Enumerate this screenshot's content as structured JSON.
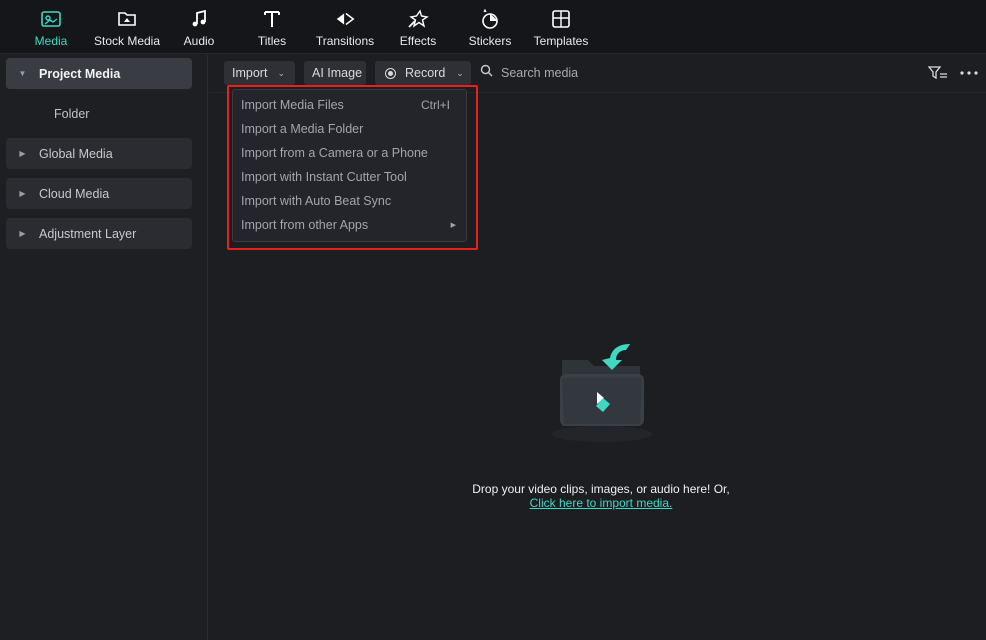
{
  "toolbar": {
    "tabs": [
      {
        "label": "Media",
        "icon": "media-icon",
        "active": true
      },
      {
        "label": "Stock Media",
        "icon": "stock-media-icon",
        "active": false
      },
      {
        "label": "Audio",
        "icon": "music-note-icon",
        "active": false
      },
      {
        "label": "Titles",
        "icon": "titles-icon",
        "active": false
      },
      {
        "label": "Transitions",
        "icon": "transitions-icon",
        "active": false
      },
      {
        "label": "Effects",
        "icon": "effects-icon",
        "active": false
      },
      {
        "label": "Stickers",
        "icon": "stickers-icon",
        "active": false
      },
      {
        "label": "Templates",
        "icon": "templates-icon",
        "active": false
      }
    ]
  },
  "sidebar": {
    "items": [
      {
        "label": "Project Media",
        "expanded": true
      },
      {
        "label": "Folder"
      },
      {
        "label": "Global Media",
        "expanded": false
      },
      {
        "label": "Cloud Media",
        "expanded": false
      },
      {
        "label": "Adjustment Layer",
        "expanded": false
      }
    ]
  },
  "main": {
    "import_label": "Import",
    "ai_image_label": "AI Image",
    "record_label": "Record",
    "search_placeholder": "Search media"
  },
  "import_menu": {
    "items": [
      {
        "label": "Import Media Files",
        "shortcut": "Ctrl+I"
      },
      {
        "label": "Import a Media Folder"
      },
      {
        "label": "Import from a Camera or a Phone"
      },
      {
        "label": "Import with Instant Cutter Tool"
      },
      {
        "label": "Import with Auto Beat Sync"
      },
      {
        "label": "Import from other Apps",
        "has_submenu": true
      }
    ]
  },
  "empty_state": {
    "text": "Drop your video clips, images, or audio here! Or,",
    "link": "Click here to import media."
  },
  "colors": {
    "accent": "#3fd8c3",
    "highlight_border": "#e8221b",
    "background": "#1c1e22"
  }
}
